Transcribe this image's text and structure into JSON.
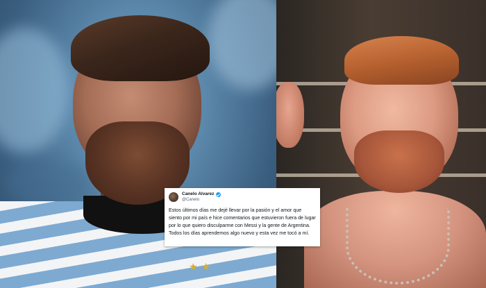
{
  "images": {
    "left": {
      "alt": "Lionel Messi in Argentina jersey"
    },
    "right": {
      "alt": "Canelo Alvarez in boxing ring"
    }
  },
  "tweet": {
    "display_name": "Canelo Alvarez",
    "handle": "@Canelo",
    "verified": true,
    "text": "Estos últimos días me dejé llevar por la pasión y el amor que siento por mi país e hice comentarios que estuvieron fuera de lugar por lo que quiero disculparme con Messi y la gente de Argentina. Todos los días aprendemos algo nuevo y esta vez me tocó a mí."
  },
  "colors": {
    "verified_blue": "#1d9bf0",
    "text_primary": "#0f1419",
    "text_secondary": "#536471"
  }
}
